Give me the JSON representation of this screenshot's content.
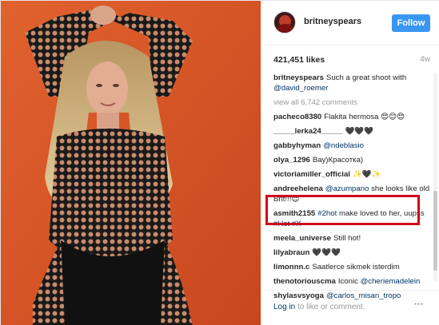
{
  "post": {
    "username": "britneyspears",
    "follow_label": "Follow",
    "likes": "421,451 likes",
    "time": "4w",
    "caption_user": "britneyspears",
    "caption_text": "Such a great shoot with",
    "caption_mention": "@david_roemer",
    "view_all": "view all 6,742 comments"
  },
  "comments": [
    {
      "user": "pacheco8380",
      "text": "Flakita hermosa 😍😊😍",
      "mention": ""
    },
    {
      "user": "_____lerka24_____",
      "text": "🖤🖤🖤",
      "mention": ""
    },
    {
      "user": "gabbyhyman",
      "text": "",
      "mention": "@ndeblasio"
    },
    {
      "user": "olya_1296",
      "text": "Вау)Красотка)",
      "mention": ""
    },
    {
      "user": "victoriamiller_official",
      "text": "✨🖤✨",
      "mention": ""
    },
    {
      "user": "andreehelena",
      "text": "she looks like old Brit!!!😍",
      "mention": "@azumpano"
    },
    {
      "user": "asmith2155",
      "text": "make loved to her, uupss",
      "mention": "#2hot",
      "mention2": "#Hot #X"
    },
    {
      "user": "meela_universe",
      "text": "Still hot!",
      "mention": ""
    },
    {
      "user": "lilyabraun",
      "text": "🖤🖤🖤",
      "mention": ""
    },
    {
      "user": "limonnn.c",
      "text": "Saatlerce sikmek isterdim",
      "mention": ""
    },
    {
      "user": "thenotoriouscma",
      "text": "Iconic",
      "mention": "@cheriemadelein"
    },
    {
      "user": "shylasvsyoga",
      "text": "",
      "mention": "@carlos_misan_tropo"
    }
  ],
  "footer": {
    "login_link": "Log in",
    "login_rest": "to like or comment.",
    "more_icon": "ellipsis-icon"
  },
  "colors": {
    "photo_bg": "#d85a2a",
    "follow_bg": "#3897f0",
    "highlight": "#d0021b",
    "link": "#003569"
  }
}
